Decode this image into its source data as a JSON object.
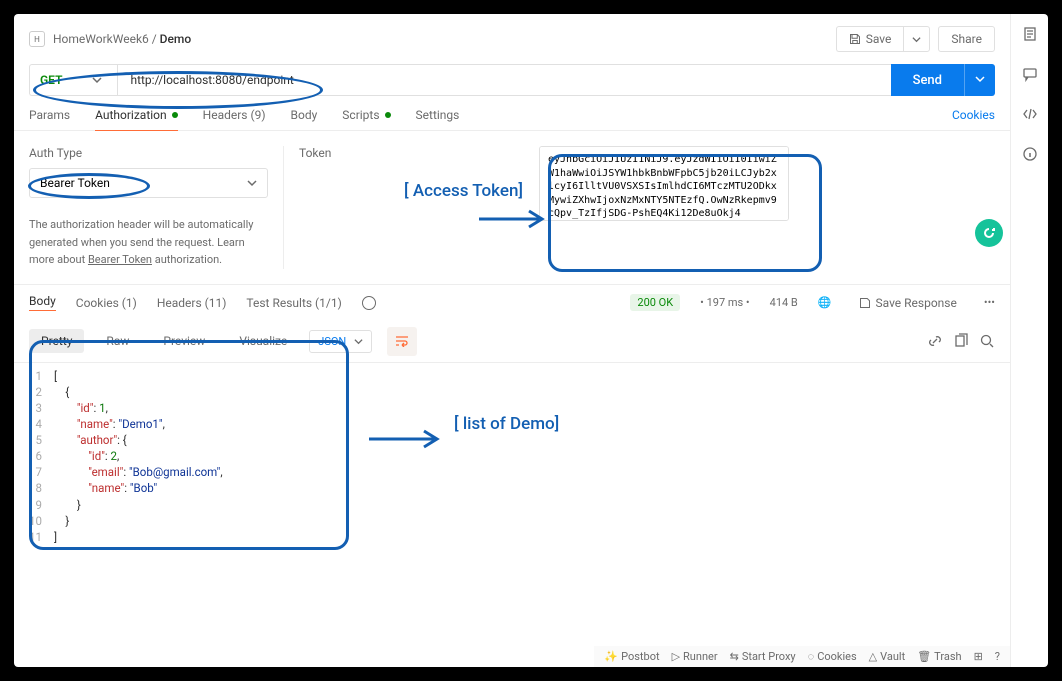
{
  "breadcrumb": {
    "workspace": "HomeWorkWeek6",
    "item": "Demo"
  },
  "topActions": {
    "save": "Save",
    "share": "Share"
  },
  "request": {
    "method": "GET",
    "url": "http://localhost:8080/endpoint",
    "send": "Send"
  },
  "reqTabs": {
    "params": "Params",
    "auth": "Authorization",
    "headers": "Headers (9)",
    "body": "Body",
    "scripts": "Scripts",
    "settings": "Settings",
    "cookies": "Cookies"
  },
  "auth": {
    "typeLabel": "Auth Type",
    "typeValue": "Bearer Token",
    "tokenLabel": "Token",
    "token": "eyJhbGciOiJIUzI1NiJ9.eyJzdWIiOiI0IiwiZW1haWwiOiJSYW1hbkBnbWFpbC5jb20iLCJyb2xlcyI6IlltVU0VSXSIsImlhdCI6MTczMTU2ODkxMywiZXhwIjoxNzMxNTY5NTEzfQ.OwNzRkepmv9cQpv_TzIfjSDG-PshEQ4Ki12De8uOkj4",
    "hint": "The authorization header will be automatically generated when you send the request. Learn more about ",
    "hintLink": "Bearer Token",
    "hintSuffix": " authorization."
  },
  "resTabs": {
    "body": "Body",
    "cookies": "Cookies (1)",
    "headers": "Headers (11)",
    "tests": "Test Results (1/1)"
  },
  "status": {
    "code": "200 OK",
    "time": "197 ms",
    "size": "414 B",
    "saveResponse": "Save Response"
  },
  "fmt": {
    "pretty": "Pretty",
    "raw": "Raw",
    "preview": "Preview",
    "visualize": "Visualize",
    "json": "JSON"
  },
  "responseJson": [
    "[",
    "    {",
    "        \"id\": 1,",
    "        \"name\": \"Demo1\",",
    "        \"author\": {",
    "            \"id\": 2,",
    "            \"email\": \"Bob@gmail.com\",",
    "            \"name\": \"Bob\"",
    "        }",
    "    }",
    "]"
  ],
  "footer": {
    "postbot": "Postbot",
    "runner": "Runner",
    "proxy": "Start Proxy",
    "cookies": "Cookies",
    "vault": "Vault",
    "trash": "Trash"
  },
  "anno": {
    "accessToken": "[ Access Token]",
    "listDemo": "[ list of Demo]"
  }
}
